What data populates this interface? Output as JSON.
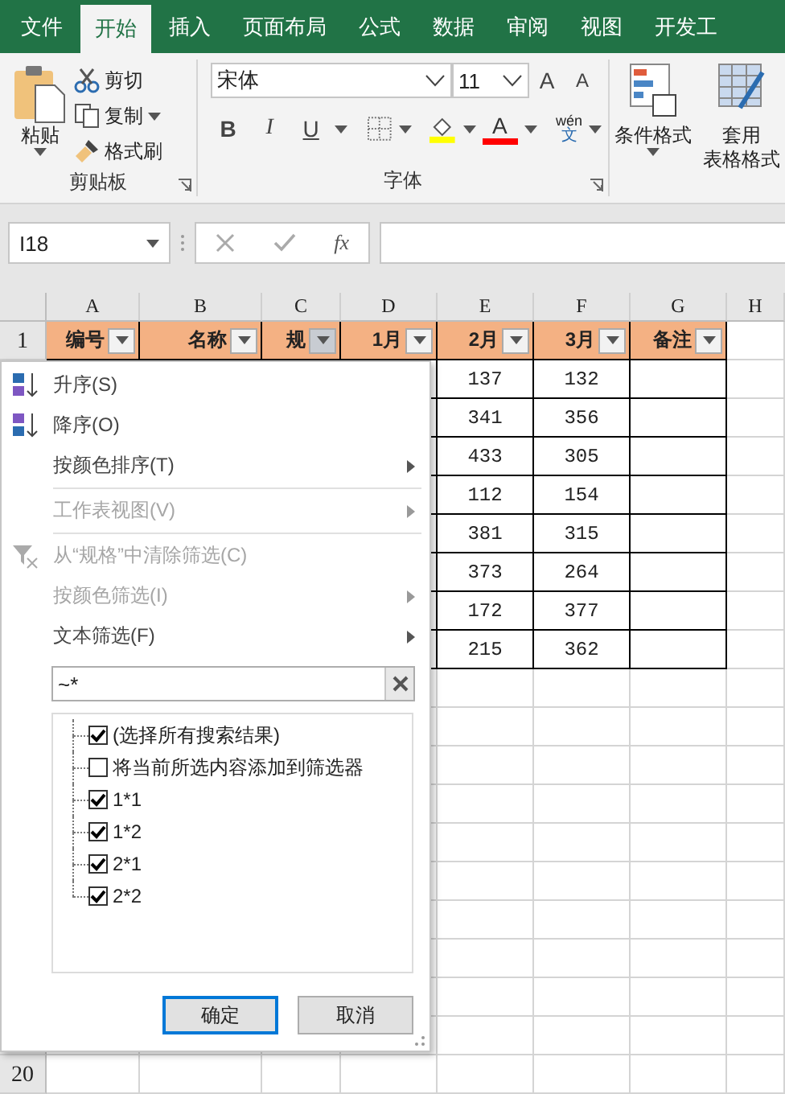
{
  "ribbon_tabs": [
    {
      "label": "文件",
      "selected": false
    },
    {
      "label": "开始",
      "selected": true
    },
    {
      "label": "插入",
      "selected": false
    },
    {
      "label": "页面布局",
      "selected": false
    },
    {
      "label": "公式",
      "selected": false
    },
    {
      "label": "数据",
      "selected": false
    },
    {
      "label": "审阅",
      "selected": false
    },
    {
      "label": "视图",
      "selected": false
    },
    {
      "label": "开发工",
      "selected": false
    }
  ],
  "clipboard": {
    "paste": "粘贴",
    "cut": "剪切",
    "copy": "复制",
    "format_painter": "格式刷",
    "group_label": "剪贴板"
  },
  "font": {
    "name": "宋体",
    "size": "11",
    "grow": "A",
    "shrink": "A",
    "bold": "B",
    "italic": "I",
    "underline": "U",
    "font_color": "A",
    "phonetic_top": "wén",
    "phonetic_bottom": "文",
    "group_label": "字体"
  },
  "styles": {
    "conditional": "条件格式",
    "table_line1": "套用",
    "table_line2": "表格格式"
  },
  "formula_bar": {
    "name_box": "I18",
    "function_symbol": "fx"
  },
  "sheet": {
    "columns": [
      "A",
      "B",
      "C",
      "D",
      "E",
      "F",
      "G",
      "H"
    ],
    "header_row_label": "1",
    "headers": [
      {
        "text": "编号",
        "filter_active": false
      },
      {
        "text": "名称",
        "filter_active": false
      },
      {
        "text": "规",
        "filter_active": true
      },
      {
        "text": "1月",
        "filter_active": false
      },
      {
        "text": "2月",
        "filter_active": false
      },
      {
        "text": "3月",
        "filter_active": false
      },
      {
        "text": "备注",
        "filter_active": false
      }
    ],
    "rows": [
      {
        "e": "137",
        "f": "132"
      },
      {
        "e": "341",
        "f": "356"
      },
      {
        "e": "433",
        "f": "305"
      },
      {
        "e": "112",
        "f": "154"
      },
      {
        "e": "381",
        "f": "315"
      },
      {
        "e": "373",
        "f": "264"
      },
      {
        "e": "172",
        "f": "377"
      },
      {
        "e": "215",
        "f": "362"
      }
    ],
    "last_row_label": "20"
  },
  "filter_menu": {
    "items": [
      {
        "kind": "sort_asc",
        "label": "升序(S)",
        "disabled": false,
        "submenu": false
      },
      {
        "kind": "sort_desc",
        "label": "降序(O)",
        "disabled": false,
        "submenu": false
      },
      {
        "kind": "plain",
        "label": "按颜色排序(T)",
        "disabled": false,
        "submenu": true
      },
      {
        "kind": "separator"
      },
      {
        "kind": "plain",
        "label": "工作表视图(V)",
        "disabled": true,
        "submenu": true
      },
      {
        "kind": "separator"
      },
      {
        "kind": "clear_filter",
        "label": "从“规格”中清除筛选(C)",
        "disabled": true,
        "submenu": false
      },
      {
        "kind": "plain",
        "label": "按颜色筛选(I)",
        "disabled": true,
        "submenu": true
      },
      {
        "kind": "plain",
        "label": "文本筛选(F)",
        "disabled": false,
        "submenu": true
      }
    ],
    "search": {
      "value": "~*"
    },
    "options": [
      {
        "label": "(选择所有搜索结果)",
        "checked": true
      },
      {
        "label": "将当前所选内容添加到筛选器",
        "checked": false
      },
      {
        "label": "1*1",
        "checked": true
      },
      {
        "label": "1*2",
        "checked": true
      },
      {
        "label": "2*1",
        "checked": true
      },
      {
        "label": "2*2",
        "checked": true
      }
    ],
    "buttons": [
      {
        "label": "确定",
        "focused": true
      },
      {
        "label": "取消",
        "focused": false
      }
    ]
  }
}
